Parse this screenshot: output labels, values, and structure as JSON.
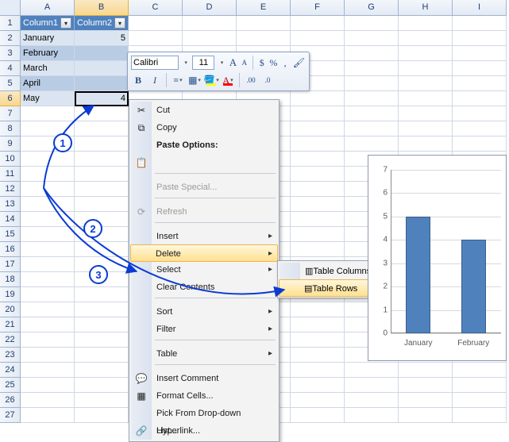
{
  "columns": [
    "A",
    "B",
    "C",
    "D",
    "E",
    "F",
    "G",
    "H",
    "I"
  ],
  "rowCount": 27,
  "table": {
    "headers": [
      "Column1",
      "Column2"
    ],
    "rows": [
      {
        "c1": "January",
        "c2": "5"
      },
      {
        "c1": "February",
        "c2": ""
      },
      {
        "c1": "March",
        "c2": ""
      },
      {
        "c1": "April",
        "c2": ""
      },
      {
        "c1": "May",
        "c2": "4"
      }
    ],
    "activeCell": "B6"
  },
  "miniToolbar": {
    "fontName": "Calibri",
    "fontSize": "11"
  },
  "contextMenu": {
    "cut": "Cut",
    "copy": "Copy",
    "pasteOptionsLabel": "Paste Options:",
    "pasteSpecial": "Paste Special...",
    "refresh": "Refresh",
    "insert": "Insert",
    "delete": "Delete",
    "select": "Select",
    "clearContents": "Clear Contents",
    "sort": "Sort",
    "filter": "Filter",
    "table": "Table",
    "insertComment": "Insert Comment",
    "formatCells": "Format Cells...",
    "pickFromList": "Pick From Drop-down List...",
    "hyperlink": "Hyperlink..."
  },
  "subMenu": {
    "tableColumns": "Table Columns",
    "tableRows": "Table Rows"
  },
  "annotations": {
    "a1": "1",
    "a2": "2",
    "a3": "3"
  },
  "chart_data": {
    "type": "bar",
    "categories": [
      "January",
      "February"
    ],
    "values": [
      5,
      4
    ],
    "title": "",
    "xlabel": "",
    "ylabel": "",
    "ylim": [
      0,
      7
    ],
    "yticks": [
      0,
      1,
      2,
      3,
      4,
      5,
      6,
      7
    ]
  }
}
